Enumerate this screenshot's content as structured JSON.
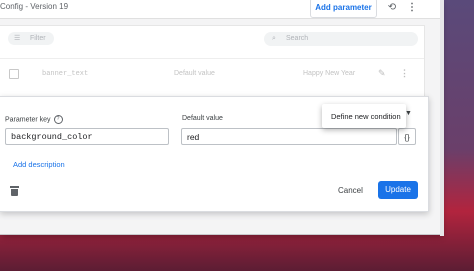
{
  "header": {
    "title": "Config - Version 19",
    "add_parameter_label": "Add parameter",
    "history_icon": "history-icon",
    "more_icon": "more-vert-icon"
  },
  "table": {
    "filter_placeholder": "Filter",
    "search_placeholder": "Search",
    "rows": [
      {
        "key": "banner_text",
        "default_value": "Default value",
        "condition_value": "Happy New Year"
      }
    ]
  },
  "editor": {
    "parameter_key_label": "Parameter key",
    "parameter_key_value": "background_color",
    "default_value_label": "Default value",
    "default_value_value": "red",
    "braces_label": "{}",
    "menu_item": "Define new condition",
    "add_description_label": "Add description",
    "cancel_label": "Cancel",
    "update_label": "Update"
  },
  "colors": {
    "accent": "#1a73e8"
  }
}
